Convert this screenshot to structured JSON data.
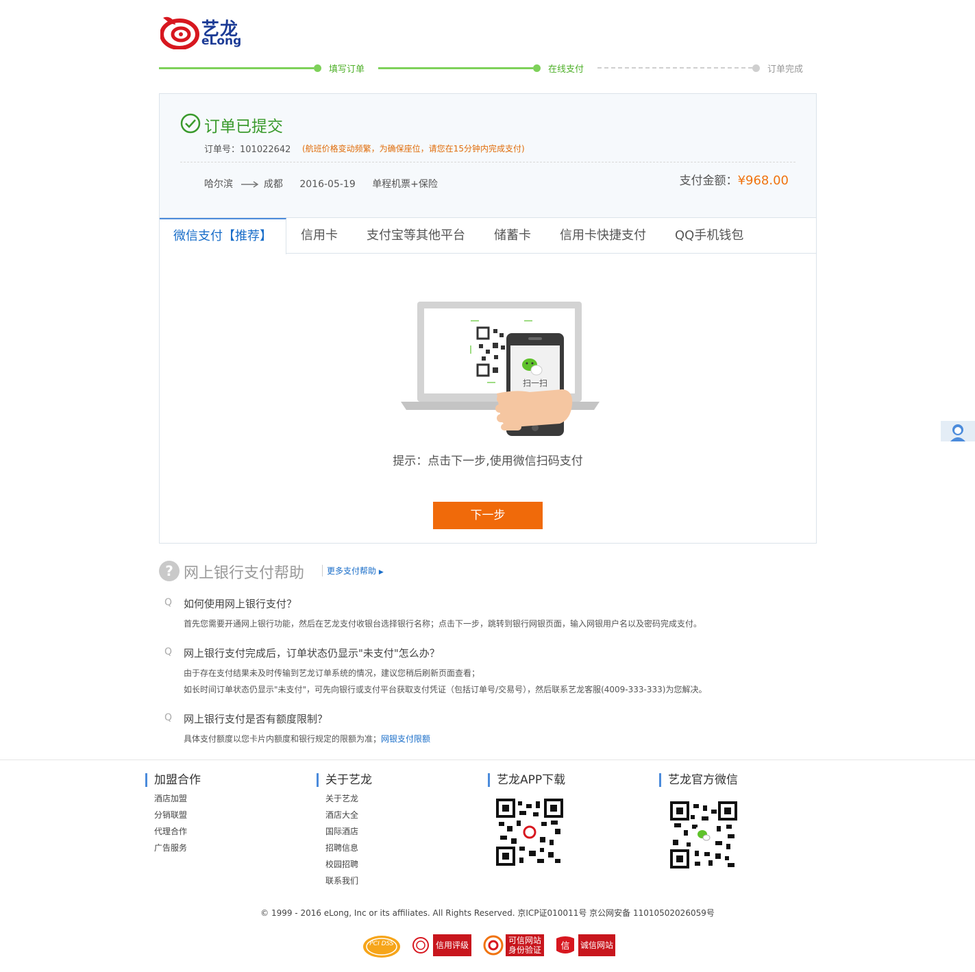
{
  "logo": {
    "cn": "艺龙",
    "en": "eLong"
  },
  "steps": [
    {
      "label": "填写订单",
      "state": "done"
    },
    {
      "label": "在线支付",
      "state": "current"
    },
    {
      "label": "订单完成",
      "state": "pending"
    }
  ],
  "order": {
    "title": "订单已提交",
    "number_label": "订单号：101022642",
    "warning": "(航班价格变动频繁，为确保座位，请您在15分钟内完成支付)",
    "from": "哈尔滨",
    "to": "成都",
    "date": "2016-05-19",
    "product": "单程机票+保险",
    "amount_label": "支付金额：",
    "amount_value": "¥968.00"
  },
  "tabs": [
    {
      "label": "微信支付【推荐】",
      "active": true
    },
    {
      "label": "信用卡"
    },
    {
      "label": "支付宝等其他平台"
    },
    {
      "label": "储蓄卡"
    },
    {
      "label": "信用卡快捷支付"
    },
    {
      "label": "QQ手机钱包"
    }
  ],
  "wechat": {
    "phone_text": "扫一扫",
    "tip": "提示：点击下一步,使用微信扫码支付",
    "next_button": "下一步"
  },
  "help": {
    "title": "网上银行支付帮助",
    "more": "更多支付帮助",
    "items": [
      {
        "q": "如何使用网上银行支付？",
        "a": [
          "首先您需要开通网上银行功能，然后在艺龙支付收银台选择银行名称；点击下一步，跳转到银行网银页面，输入网银用户名以及密码完成支付。"
        ]
      },
      {
        "q": "网上银行支付完成后，订单状态仍显示\"未支付\"怎么办？",
        "a": [
          "由于存在支付结果未及时传输到艺龙订单系统的情况，建议您稍后刷新页面查看；",
          "如长时间订单状态仍显示\"未支付\"，可先向银行或支付平台获取支付凭证（包括订单号/交易号），然后联系艺龙客服(4009-333-333)为您解决。"
        ]
      },
      {
        "q": "网上银行支付是否有额度限制？",
        "a": [
          "具体支付额度以您卡片内额度和银行规定的限额为准；"
        ],
        "link": "网银支付限额"
      }
    ]
  },
  "footer": {
    "cols": [
      {
        "title": "加盟合作",
        "links": [
          "酒店加盟",
          "分销联盟",
          "代理合作",
          "广告服务"
        ]
      },
      {
        "title": "关于艺龙",
        "links": [
          "关于艺龙",
          "酒店大全",
          "国际酒店",
          "招聘信息",
          "校园招聘",
          "联系我们"
        ]
      },
      {
        "title": "艺龙APP下载",
        "links": []
      },
      {
        "title": "艺龙官方微信",
        "links": []
      }
    ],
    "copyright": "© 1999 - 2016 eLong, Inc or its affiliates. All Rights Reserved. 京ICP证010011号 京公网安备 11010502026059号",
    "badges": {
      "pci": "PCI DSS",
      "credit": "信用评级",
      "trusted1": "可信网站",
      "trusted2": "身份验证",
      "honest": "诚信网站"
    }
  },
  "colors": {
    "green": "#3a9a2c",
    "progress": "#7ed15a",
    "blue": "#1a6ec9",
    "orange": "#f06a0a",
    "red": "#c8161d"
  }
}
